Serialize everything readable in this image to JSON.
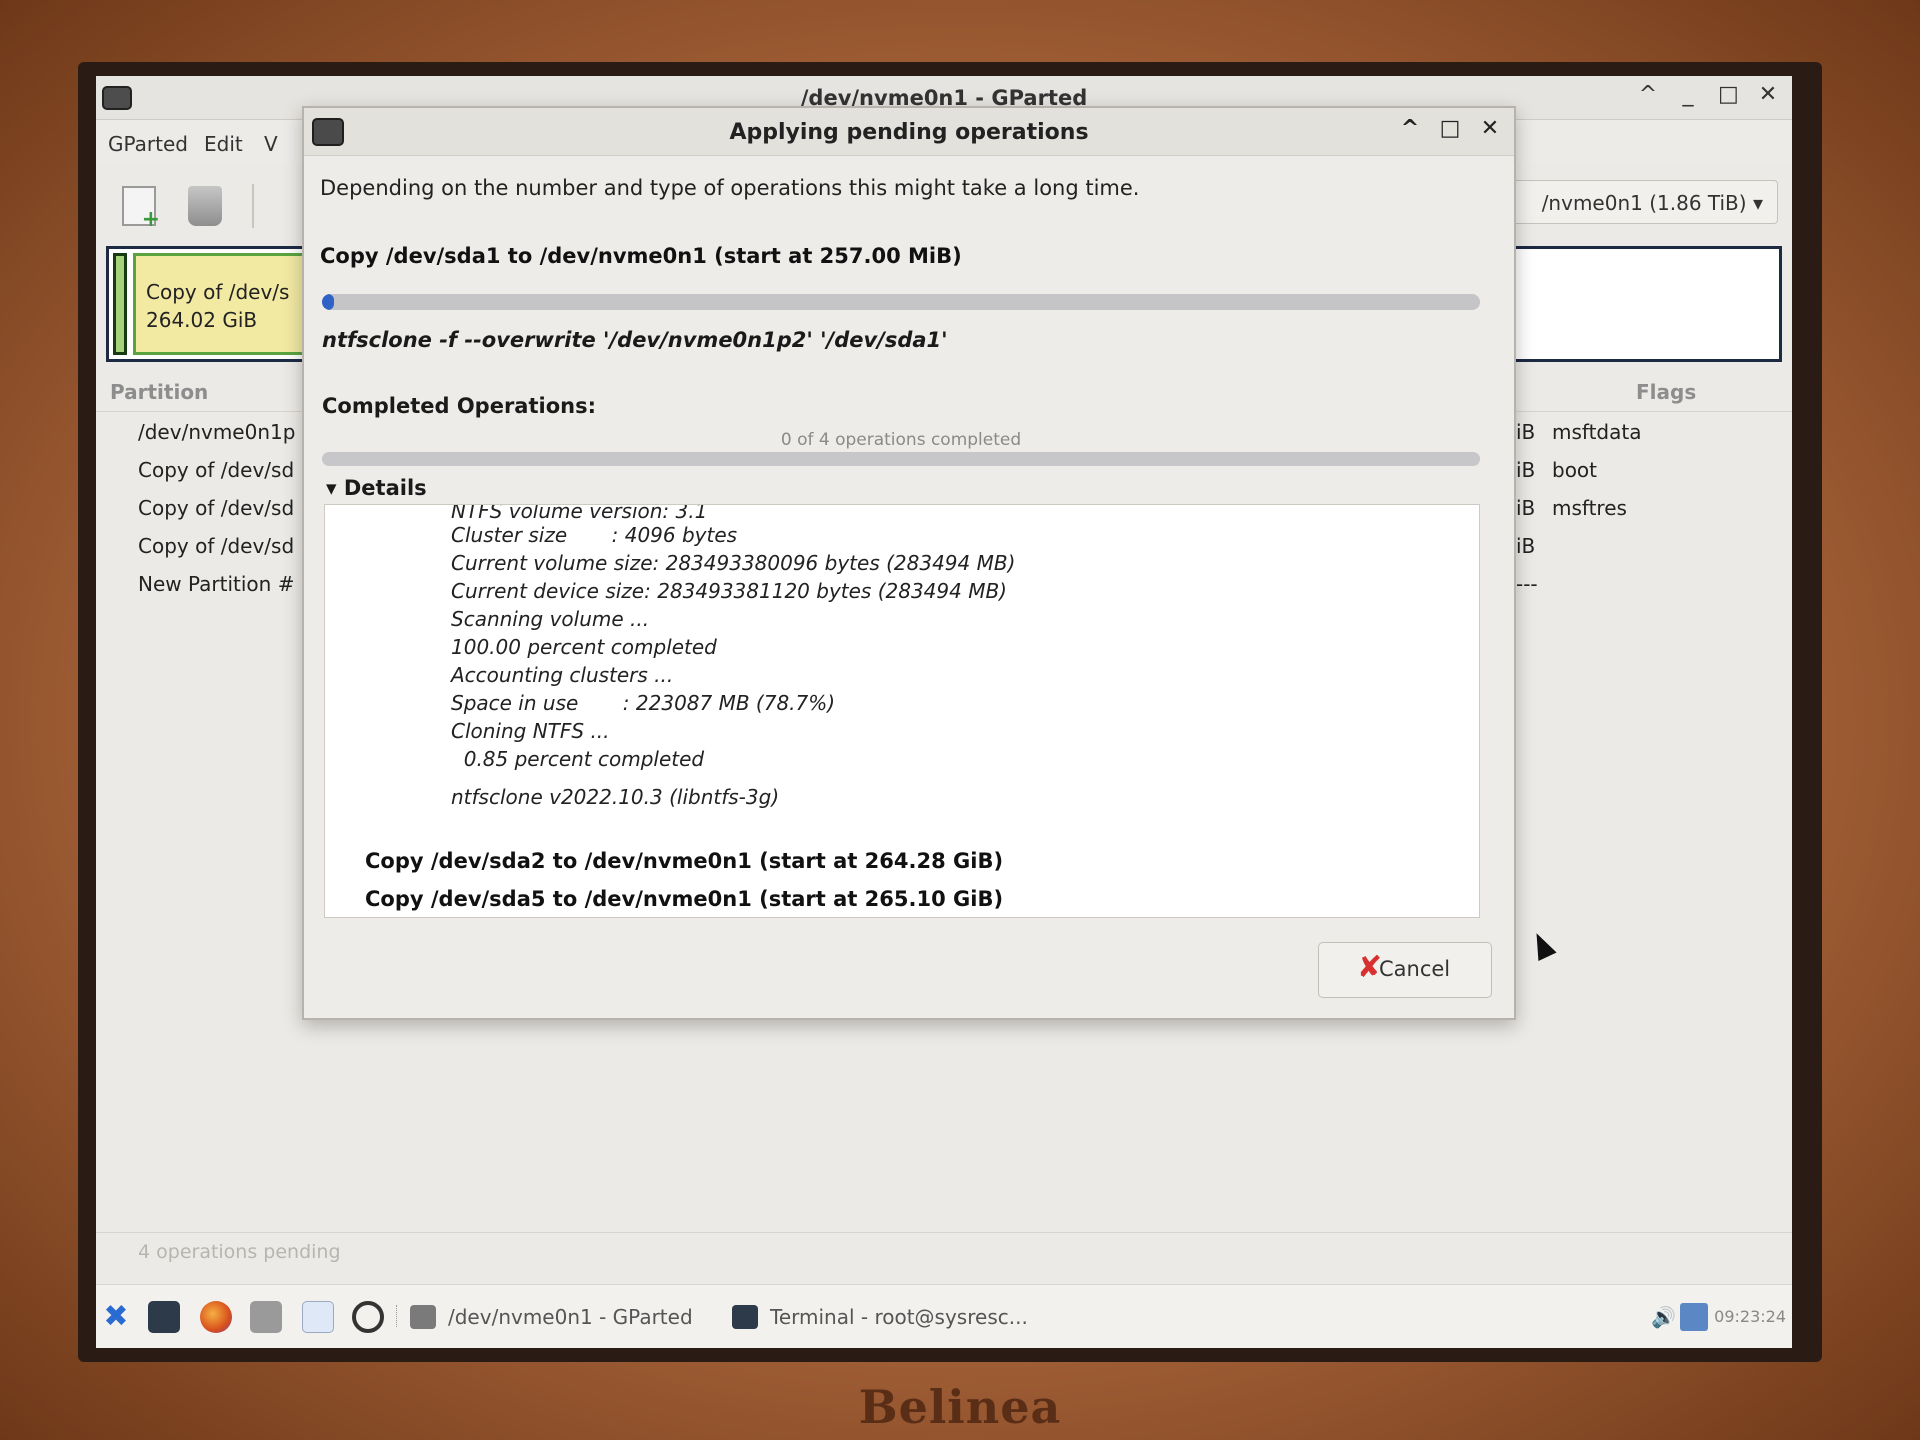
{
  "brand": "Belinea",
  "main_window": {
    "title": "/dev/nvme0n1 - GParted",
    "controls": [
      "^",
      "_",
      "□",
      "✕"
    ],
    "menu": [
      "GParted",
      "Edit",
      "V"
    ],
    "device": "/nvme0n1 (1.86 TiB)",
    "graph_label_line1": "Copy of /dev/s",
    "graph_label_line2": "264.02 GiB",
    "columns": {
      "partition": "Partition",
      "flags": "Flags"
    },
    "rows": [
      {
        "name": "/dev/nvme0n1p",
        "size_suffix": "iB",
        "flags": "msftdata"
      },
      {
        "name": "Copy of /dev/sd",
        "size_suffix": "iB",
        "flags": "boot"
      },
      {
        "name": "Copy of /dev/sd",
        "size_suffix": "iB",
        "flags": "msftres"
      },
      {
        "name": "Copy of /dev/sd",
        "size_suffix": "iB",
        "flags": ""
      },
      {
        "name": "New Partition #",
        "size_suffix": "---",
        "flags": ""
      }
    ],
    "status": "4 operations pending"
  },
  "dialog": {
    "title": "Applying pending operations",
    "intro": "Depending on the number and type of operations this might take a long time.",
    "current_operation": "Copy /dev/sda1 to /dev/nvme0n1 (start at 257.00 MiB)",
    "progress_fraction": 0.01,
    "command": "ntfsclone -f --overwrite '/dev/nvme0n1p2' '/dev/sda1'",
    "completed_heading": "Completed Operations:",
    "ops_completed_text": "0 of 4 operations completed",
    "details_label": "Details",
    "details_lines": [
      "NTFS volume version: 3.1",
      "Cluster size       : 4096 bytes",
      "Current volume size: 283493380096 bytes (283494 MB)",
      "Current device size: 283493381120 bytes (283494 MB)",
      "Scanning volume ...",
      "100.00 percent completed",
      "Accounting clusters ...",
      "Space in use       : 223087 MB (78.7%)",
      "Cloning NTFS ...",
      "  0.85 percent completed",
      "ntfsclone v2022.10.3 (libntfs-3g)"
    ],
    "pending_ops": [
      "Copy /dev/sda2 to /dev/nvme0n1 (start at 264.28 GiB)",
      "Copy /dev/sda5 to /dev/nvme0n1 (start at 265.10 GiB)"
    ],
    "cancel_label": "Cancel"
  },
  "taskbar": {
    "tasks": [
      {
        "label": "/dev/nvme0n1 - GParted"
      },
      {
        "label": "Terminal - root@sysresc..."
      }
    ],
    "clock": "09:23:24"
  }
}
